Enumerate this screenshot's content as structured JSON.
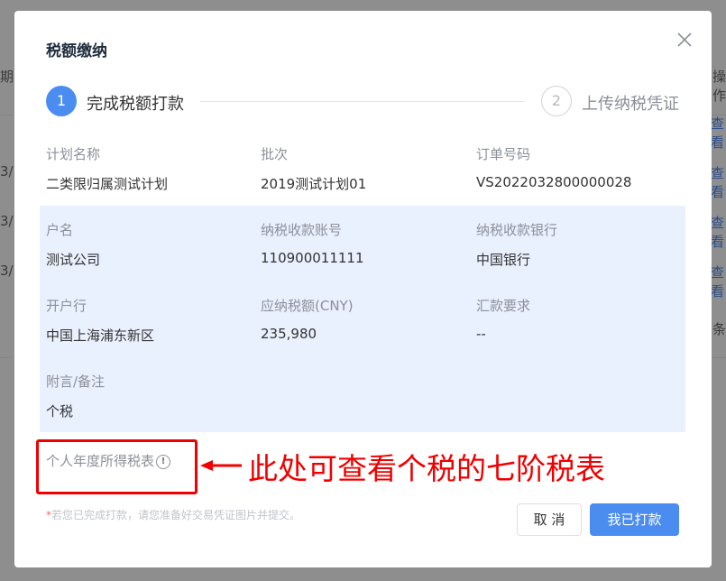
{
  "background": {
    "col_left_header": "期",
    "col_right_header": "操作",
    "left_fragments": [
      "3/",
      "3/",
      "3/"
    ],
    "right_links": [
      "查看",
      "查看",
      "查看",
      "查看"
    ],
    "right_fragment_bottom": "条"
  },
  "dialog": {
    "title": "税额缴纳",
    "steps": [
      {
        "number": "1",
        "label": "完成税额打款"
      },
      {
        "number": "2",
        "label": "上传纳税凭证"
      }
    ],
    "plan": {
      "name_label": "计划名称",
      "name_value": "二类限归属测试计划",
      "batch_label": "批次",
      "batch_value": "2019测试计划01",
      "order_label": "订单号码",
      "order_value": "VS2022032800000028"
    },
    "account": {
      "holder_label": "户名",
      "holder_value": "测试公司",
      "account_no_label": "纳税收款账号",
      "account_no_value": "110900011111",
      "bank_label": "纳税收款银行",
      "bank_value": "中国银行",
      "branch_label": "开户行",
      "branch_value": "中国上海浦东新区",
      "amount_label": "应纳税额(CNY)",
      "amount_value": "235,980",
      "remit_label": "汇款要求",
      "remit_value": "--",
      "note_label": "附言/备注",
      "note_value": "个税"
    },
    "tax_table_link": "个人年度所得税表",
    "hint_star": "*",
    "hint": "若您已完成打款，请您准备好交易凭证图片并提交。",
    "cancel_label": "取 消",
    "paid_label": "我已打款"
  },
  "annotation": {
    "text": "此处可查看个税的七阶税表",
    "color": "#f00000"
  },
  "colors": {
    "primary": "#4a8cf0",
    "panel_bg": "#e9f0fe",
    "overlay": "#8e8e8e"
  }
}
